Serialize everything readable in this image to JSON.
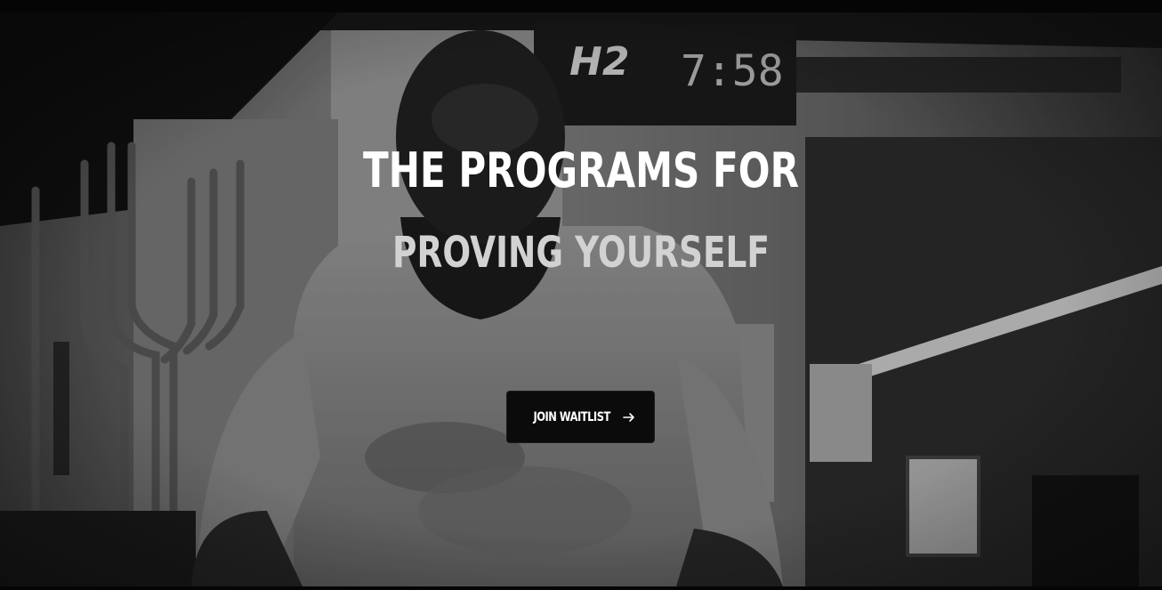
{
  "hero": {
    "headline": "THE PROGRAMS FOR",
    "subheadline": "PROVING YOURSELF",
    "background_image": "black-and-white-gym-athlete-photo",
    "scoreboard_text": "H2",
    "scoreboard_time": "7:58"
  },
  "cta": {
    "label": "JOIN WAITLIST",
    "icon": "arrow-right-icon"
  },
  "colors": {
    "headline": "#ffffff",
    "subheadline": "#d2d2d2",
    "button_bg": "#0b0b0b",
    "button_text": "#ffffff"
  }
}
